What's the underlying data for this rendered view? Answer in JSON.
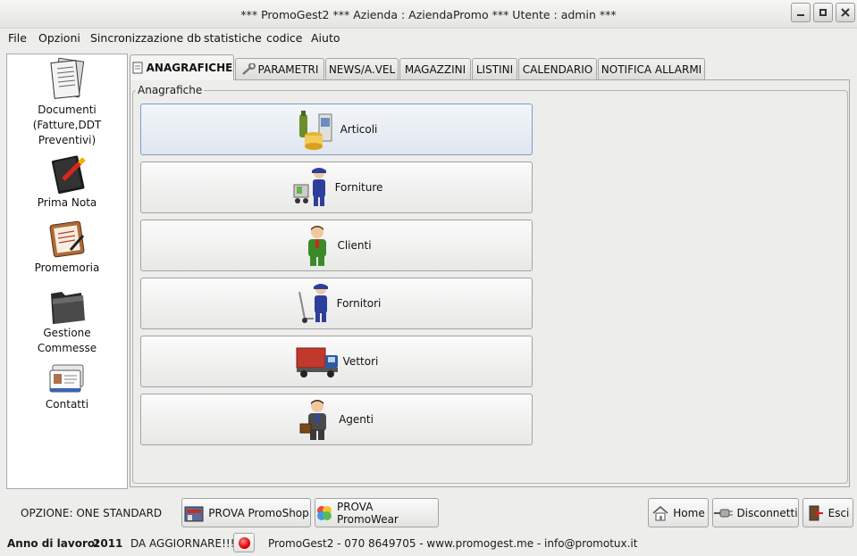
{
  "window": {
    "title": "*** PromoGest2 *** Azienda : AziendaPromo  *** Utente : admin ***",
    "minimize_icon": "minimize-icon",
    "maximize_icon": "maximize-icon",
    "close_icon": "close-icon"
  },
  "menu": [
    "File",
    "Opzioni",
    "Sincronizzazione db",
    "statistiche",
    "codice",
    "Aiuto"
  ],
  "sidebar": {
    "items": [
      {
        "label": "Documenti\n(Fatture,DDT\nPreventivi)",
        "icon": "documents-icon"
      },
      {
        "label": "Prima Nota",
        "icon": "notebook-icon"
      },
      {
        "label": "Promemoria",
        "icon": "memo-board-icon"
      },
      {
        "label": "Gestione\nCommesse",
        "icon": "folder-icon"
      },
      {
        "label": "Contatti",
        "icon": "contact-cards-icon"
      }
    ]
  },
  "tabs": [
    {
      "label": "ANAGRAFICHE",
      "active": true,
      "icon": "document-icon"
    },
    {
      "label": "PARAMETRI",
      "active": false,
      "icon": "wrench-icon"
    },
    {
      "label": "NEWS/A.VEL",
      "active": false
    },
    {
      "label": "MAGAZZINI",
      "active": false
    },
    {
      "label": "LISTINI",
      "active": false
    },
    {
      "label": "CALENDARIO",
      "active": false
    },
    {
      "label": "NOTIFICA ALLARMI",
      "active": false
    }
  ],
  "anagrafiche": {
    "frame_label": "Anagrafiche",
    "buttons": [
      {
        "label": "Articoli",
        "icon": "products-icon"
      },
      {
        "label": "Forniture",
        "icon": "supplier-trolley-icon"
      },
      {
        "label": "Clienti",
        "icon": "customer-person-icon"
      },
      {
        "label": "Fornitori",
        "icon": "supplier-handtruck-icon"
      },
      {
        "label": "Vettori",
        "icon": "truck-icon"
      },
      {
        "label": "Agenti",
        "icon": "agent-briefcase-icon"
      }
    ]
  },
  "bottom": {
    "option_prefix": "OPZIONE:",
    "option_value": "ONE STANDARD",
    "promoshop": "PROVA PromoShop",
    "promowear": "PROVA PromoWear",
    "home": "Home",
    "disconnect": "Disconnetti",
    "exit": "Esci"
  },
  "status": {
    "year_label": "Anno di lavoro:",
    "year": "2011",
    "update": "DA AGGIORNARE!!!",
    "contact": "PromoGest2 - 070 8649705 - www.promogest.me - info@promotux.it",
    "update_led_color": "#e00000"
  }
}
